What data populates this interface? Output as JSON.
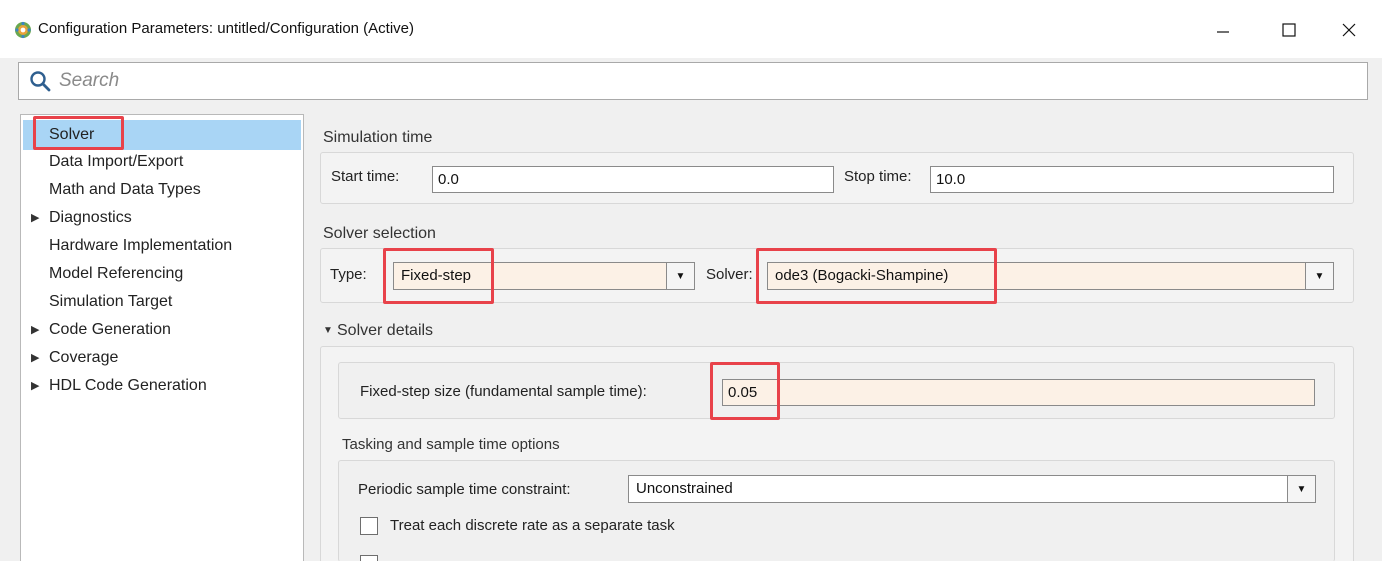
{
  "window": {
    "title": "Configuration Parameters: untitled/Configuration (Active)",
    "minimize_glyph": "—",
    "maximize_glyph": "☐",
    "close_glyph": "✕"
  },
  "search": {
    "placeholder": "Search",
    "value": ""
  },
  "sidebar": {
    "items": [
      {
        "label": "Solver",
        "expandable": false,
        "selected": true
      },
      {
        "label": "Data Import/Export",
        "expandable": false
      },
      {
        "label": "Math and Data Types",
        "expandable": false
      },
      {
        "label": "Diagnostics",
        "expandable": true
      },
      {
        "label": "Hardware Implementation",
        "expandable": false
      },
      {
        "label": "Model Referencing",
        "expandable": false
      },
      {
        "label": "Simulation Target",
        "expandable": false
      },
      {
        "label": "Code Generation",
        "expandable": true
      },
      {
        "label": "Coverage",
        "expandable": true
      },
      {
        "label": "HDL Code Generation",
        "expandable": true
      }
    ],
    "expand_glyph": "▶"
  },
  "simulation_time": {
    "title": "Simulation time",
    "start_label": "Start time:",
    "start_value": "0.0",
    "stop_label": "Stop time:",
    "stop_value": "10.0"
  },
  "solver_selection": {
    "title": "Solver selection",
    "type_label": "Type:",
    "type_value": "Fixed-step",
    "solver_label": "Solver:",
    "solver_value": "ode3 (Bogacki-Shampine)"
  },
  "solver_details": {
    "title": "Solver details",
    "collapse_glyph": "▼",
    "fixed_step_label": "Fixed-step size (fundamental sample time):",
    "fixed_step_value": "0.05"
  },
  "tasking": {
    "title": "Tasking and sample time options",
    "periodic_label": "Periodic sample time constraint:",
    "periodic_value": "Unconstrained",
    "checkbox1_label": "Treat each discrete rate as a separate task",
    "checkbox1_checked": false,
    "checkbox2_checked": false
  },
  "dropdown_glyph": "▼",
  "colors": {
    "highlight": "#e8424a",
    "selection": "#a9d5f5",
    "input_tint": "#fcf1e6"
  }
}
